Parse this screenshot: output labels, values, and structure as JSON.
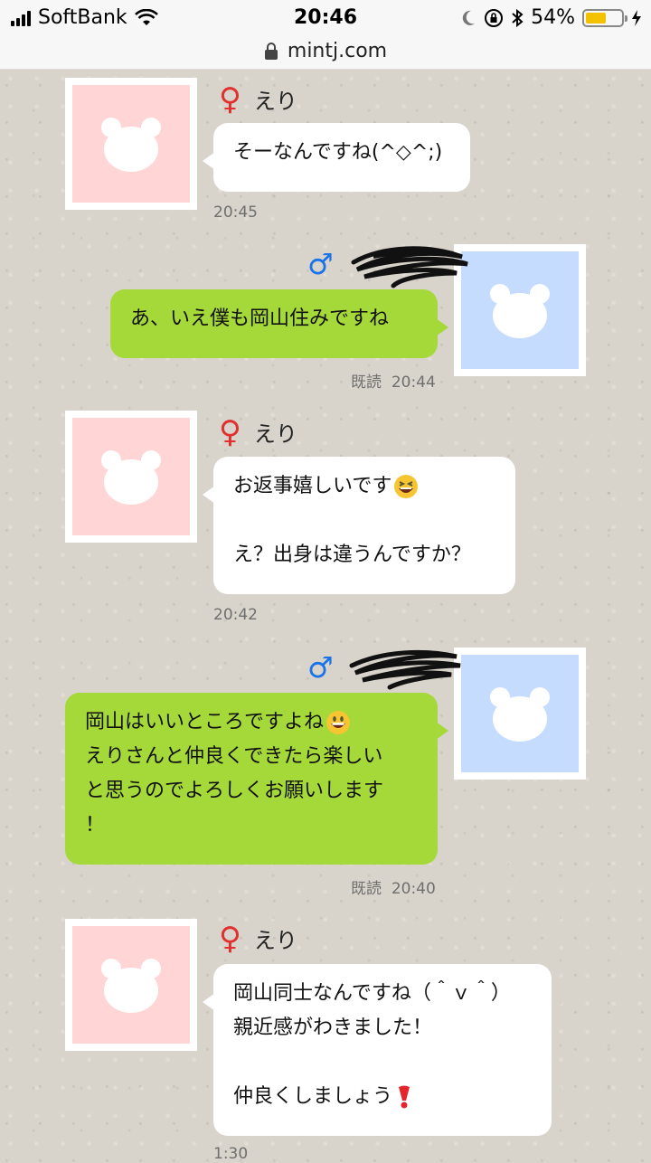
{
  "status_bar": {
    "carrier": "SoftBank",
    "time": "20:46",
    "battery": "54%"
  },
  "url_bar": {
    "domain": "mintj.com"
  },
  "messages": [
    {
      "sender": "えり",
      "side": "left",
      "lines": [
        "そーなんですね(^◇^;)"
      ],
      "time": "20:45"
    },
    {
      "sender": "",
      "side": "right",
      "lines": [
        "あ、いえ僕も岡山住みですね"
      ],
      "read": "既読",
      "time": "20:44"
    },
    {
      "sender": "えり",
      "side": "left",
      "lines": [
        "お返事嬉しいです",
        "",
        "え？出身は違うんですか？"
      ],
      "emoji": "grinning-squinting-face",
      "time": "20:42"
    },
    {
      "sender": "",
      "side": "right",
      "lines": [
        "岡山はいいところですよね",
        "えりさんと仲良くできたら楽しい",
        "と思うのでよろしくお願いします",
        "！"
      ],
      "emoji": "grinning-face",
      "read": "既読",
      "time": "20:40"
    },
    {
      "sender": "えり",
      "side": "left",
      "lines": [
        "岡山同士なんですね（＾ｖ＾）",
        "親近感がわきました！",
        "",
        "仲良くしましょう"
      ],
      "emoji": "heavy-exclamation-mark",
      "time": "1:30"
    }
  ],
  "colors": {
    "female": "#e0312e",
    "male": "#1a73e8",
    "green_bubble": "#a5d939",
    "female_avatar": "#ffd5d5",
    "male_avatar": "#c6dcff"
  },
  "icons": [
    "signal-bars-icon",
    "wifi-icon",
    "moon-icon",
    "rotation-lock-icon",
    "bluetooth-icon",
    "battery-icon",
    "charging-icon",
    "lock-icon",
    "female-symbol-icon",
    "male-symbol-icon",
    "bear-avatar-icon"
  ]
}
